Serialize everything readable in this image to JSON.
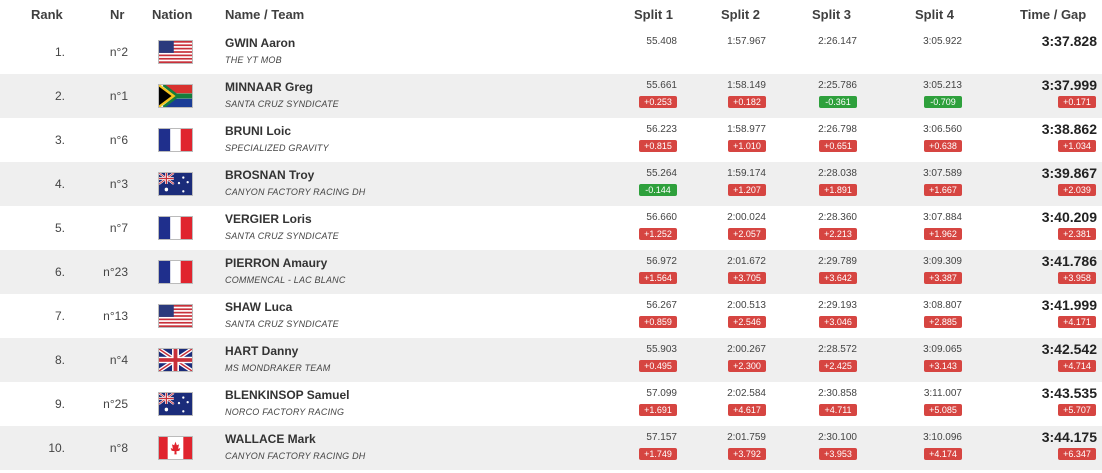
{
  "header": {
    "rank": "Rank",
    "nr": "Nr",
    "nation": "Nation",
    "name_team": "Name / Team",
    "split1": "Split 1",
    "split2": "Split 2",
    "split3": "Split 3",
    "split4": "Split 4",
    "time_gap": "Time / Gap"
  },
  "colors": {
    "gap_positive": "#d64541",
    "gap_negative": "#2ea03c",
    "row_alt": "#efefef"
  },
  "rows": [
    {
      "rank": "1.",
      "nr": "n°2",
      "nation": "usa-flag-icon",
      "name": "GWIN Aaron",
      "team": "THE YT MOB",
      "splits": [
        {
          "time": "55.408",
          "gap": ""
        },
        {
          "time": "1:57.967",
          "gap": ""
        },
        {
          "time": "2:26.147",
          "gap": ""
        },
        {
          "time": "3:05.922",
          "gap": ""
        }
      ],
      "time": "3:37.828",
      "gap": ""
    },
    {
      "rank": "2.",
      "nr": "n°1",
      "nation": "south-africa-flag-icon",
      "name": "MINNAAR Greg",
      "team": "SANTA CRUZ SYNDICATE",
      "splits": [
        {
          "time": "55.661",
          "gap": "+0.253"
        },
        {
          "time": "1:58.149",
          "gap": "+0.182"
        },
        {
          "time": "2:25.786",
          "gap": "-0.361"
        },
        {
          "time": "3:05.213",
          "gap": "-0.709"
        }
      ],
      "time": "3:37.999",
      "gap": "+0.171"
    },
    {
      "rank": "3.",
      "nr": "n°6",
      "nation": "france-flag-icon",
      "name": "BRUNI Loic",
      "team": "SPECIALIZED GRAVITY",
      "splits": [
        {
          "time": "56.223",
          "gap": "+0.815"
        },
        {
          "time": "1:58.977",
          "gap": "+1.010"
        },
        {
          "time": "2:26.798",
          "gap": "+0.651"
        },
        {
          "time": "3:06.560",
          "gap": "+0.638"
        }
      ],
      "time": "3:38.862",
      "gap": "+1.034"
    },
    {
      "rank": "4.",
      "nr": "n°3",
      "nation": "australia-flag-icon",
      "name": "BROSNAN Troy",
      "team": "CANYON FACTORY RACING DH",
      "splits": [
        {
          "time": "55.264",
          "gap": "-0.144"
        },
        {
          "time": "1:59.174",
          "gap": "+1.207"
        },
        {
          "time": "2:28.038",
          "gap": "+1.891"
        },
        {
          "time": "3:07.589",
          "gap": "+1.667"
        }
      ],
      "time": "3:39.867",
      "gap": "+2.039"
    },
    {
      "rank": "5.",
      "nr": "n°7",
      "nation": "france-flag-icon",
      "name": "VERGIER Loris",
      "team": "SANTA CRUZ SYNDICATE",
      "splits": [
        {
          "time": "56.660",
          "gap": "+1.252"
        },
        {
          "time": "2:00.024",
          "gap": "+2.057"
        },
        {
          "time": "2:28.360",
          "gap": "+2.213"
        },
        {
          "time": "3:07.884",
          "gap": "+1.962"
        }
      ],
      "time": "3:40.209",
      "gap": "+2.381"
    },
    {
      "rank": "6.",
      "nr": "n°23",
      "nation": "france-flag-icon",
      "name": "PIERRON Amaury",
      "team": "COMMENCAL - LAC BLANC",
      "splits": [
        {
          "time": "56.972",
          "gap": "+1.564"
        },
        {
          "time": "2:01.672",
          "gap": "+3.705"
        },
        {
          "time": "2:29.789",
          "gap": "+3.642"
        },
        {
          "time": "3:09.309",
          "gap": "+3.387"
        }
      ],
      "time": "3:41.786",
      "gap": "+3.958"
    },
    {
      "rank": "7.",
      "nr": "n°13",
      "nation": "usa-flag-icon",
      "name": "SHAW Luca",
      "team": "SANTA CRUZ SYNDICATE",
      "splits": [
        {
          "time": "56.267",
          "gap": "+0.859"
        },
        {
          "time": "2:00.513",
          "gap": "+2.546"
        },
        {
          "time": "2:29.193",
          "gap": "+3.046"
        },
        {
          "time": "3:08.807",
          "gap": "+2.885"
        }
      ],
      "time": "3:41.999",
      "gap": "+4.171"
    },
    {
      "rank": "8.",
      "nr": "n°4",
      "nation": "uk-flag-icon",
      "name": "HART Danny",
      "team": "MS MONDRAKER TEAM",
      "splits": [
        {
          "time": "55.903",
          "gap": "+0.495"
        },
        {
          "time": "2:00.267",
          "gap": "+2.300"
        },
        {
          "time": "2:28.572",
          "gap": "+2.425"
        },
        {
          "time": "3:09.065",
          "gap": "+3.143"
        }
      ],
      "time": "3:42.542",
      "gap": "+4.714"
    },
    {
      "rank": "9.",
      "nr": "n°25",
      "nation": "australia-flag-icon",
      "name": "BLENKINSOP Samuel",
      "team": "NORCO FACTORY RACING",
      "splits": [
        {
          "time": "57.099",
          "gap": "+1.691"
        },
        {
          "time": "2:02.584",
          "gap": "+4.617"
        },
        {
          "time": "2:30.858",
          "gap": "+4.711"
        },
        {
          "time": "3:11.007",
          "gap": "+5.085"
        }
      ],
      "time": "3:43.535",
      "gap": "+5.707"
    },
    {
      "rank": "10.",
      "nr": "n°8",
      "nation": "canada-flag-icon",
      "name": "WALLACE Mark",
      "team": "CANYON FACTORY RACING DH",
      "splits": [
        {
          "time": "57.157",
          "gap": "+1.749"
        },
        {
          "time": "2:01.759",
          "gap": "+3.792"
        },
        {
          "time": "2:30.100",
          "gap": "+3.953"
        },
        {
          "time": "3:10.096",
          "gap": "+4.174"
        }
      ],
      "time": "3:44.175",
      "gap": "+6.347"
    }
  ]
}
